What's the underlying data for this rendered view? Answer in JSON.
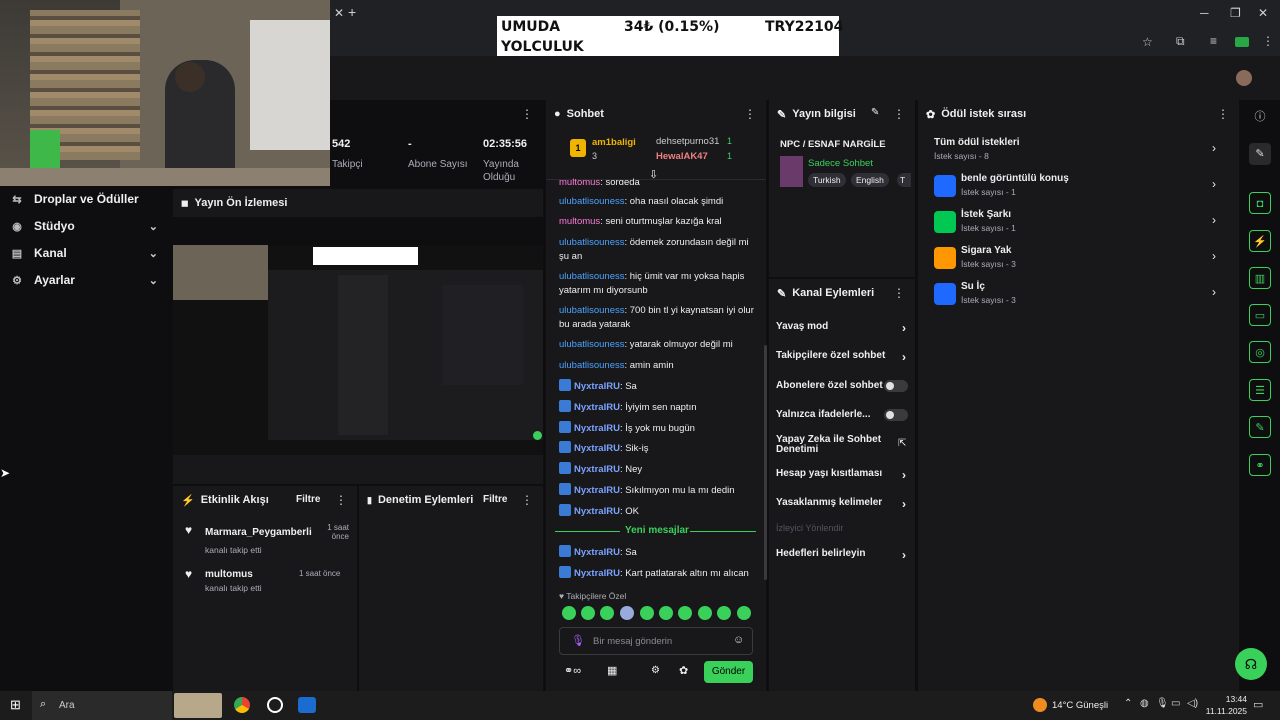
{
  "ticker": {
    "name_line1": "UMUDA",
    "name_line2": "YOLCULUK",
    "change": "34₺ (0.15%)",
    "code": "TRY22104"
  },
  "stats": [
    {
      "value": "542",
      "label": "Takipçi"
    },
    {
      "value": "-",
      "label": "Abone Sayısı"
    },
    {
      "value": "02:35:56",
      "label": "Yayında Olduğu"
    }
  ],
  "leftnav": [
    {
      "label": "Droplar ve Ödüller",
      "icon": "gift-icon"
    },
    {
      "label": "Stüdyo",
      "icon": "studio-icon"
    },
    {
      "label": "Kanal",
      "icon": "channel-icon"
    },
    {
      "label": "Ayarlar",
      "icon": "gear-icon"
    }
  ],
  "preview": {
    "title": "Yayın Ön İzlemesi"
  },
  "activity": {
    "title": "Etkinlik Akışı",
    "filter": "Filtre",
    "items": [
      {
        "user": "Marmara_Peygamberli",
        "text": "kanalı takip etti",
        "time": "1 saat önce"
      },
      {
        "user": "multomus",
        "text": "kanalı takip etti",
        "time": "1 saat önce"
      }
    ]
  },
  "moderation": {
    "title": "Denetim Eylemleri",
    "filter": "Filtre"
  },
  "chat": {
    "title": "Sohbet",
    "top_gifter": {
      "rank": "1",
      "name": "am1baligi",
      "count": "3"
    },
    "gifters": [
      {
        "name": "dehsetpurno31",
        "count": "1"
      },
      {
        "name": "HewalAK47",
        "count": "1"
      }
    ],
    "cut_msg": {
      "user": "multomus",
      "text": ": sorgeda"
    },
    "messages": [
      {
        "user": "ulubatlisouness",
        "text": ": oha nasıl olacak şimdi"
      },
      {
        "user": "multomus",
        "text": ": seni oturtmuşlar kazığa kral"
      },
      {
        "user": "ulubatlisouness",
        "text": ": ödemek zorundasın değil mi şu an"
      },
      {
        "user": "ulubatlisouness",
        "text": ": hiç ümit var mı yoksa hapis yatarım mı diyorsunb"
      },
      {
        "user": "ulubatlisouness",
        "text": ": 700 bin tl yi kaynatsan iyi olur bu arada yatarak"
      },
      {
        "user": "ulubatlisouness",
        "text": ": yatarak olmuyor değil mi"
      },
      {
        "user": "ulubatlisouness",
        "text": ": amin amin"
      },
      {
        "user": "NyxtraIRU",
        "text": ": Sa"
      },
      {
        "user": "NyxtraIRU",
        "text": ": İyiyim sen naptın"
      },
      {
        "user": "NyxtraIRU",
        "text": ": İş yok mu bugün"
      },
      {
        "user": "NyxtraIRU",
        "text": ": Sik-iş"
      },
      {
        "user": "NyxtraIRU",
        "text": ": Ney"
      },
      {
        "user": "NyxtraIRU",
        "text": ": Sıkılmıyon mu la mı dedin"
      },
      {
        "user": "NyxtraIRU",
        "text": ": OK"
      }
    ],
    "new_divider": "Yeni mesajlar",
    "new_messages": [
      {
        "user": "NyxtraIRU",
        "text": ": Sa"
      },
      {
        "user": "NyxtraIRU",
        "text": ": Kart patlatarak altın mı alıcan"
      }
    ],
    "followers_only": "Takipçilere Özel",
    "input_placeholder": "Bir mesaj gönderin",
    "send": "Gönder"
  },
  "stream_info": {
    "title": "Yayın bilgisi",
    "category": "NPC / ESNAF NARGİLE",
    "subtitle": "Sadece Sohbet",
    "tags": [
      "Turkish",
      "English",
      "T"
    ]
  },
  "channel_actions": {
    "title": "Kanal Eylemleri",
    "items": [
      {
        "label": "Yavaş mod",
        "kind": "chevron"
      },
      {
        "label": "Takipçilere özel sohbet",
        "kind": "chevron"
      },
      {
        "label": "Abonelere özel sohbet",
        "kind": "toggle"
      },
      {
        "label": "Yalnızca ifadelerle...",
        "kind": "toggle"
      },
      {
        "label": "Yapay Zeka ile Sohbet Denetimi",
        "kind": "external"
      },
      {
        "label": "Hesap yaşı kısıtlaması",
        "kind": "chevron"
      },
      {
        "label": "Yasaklanmış kelimeler",
        "kind": "chevron"
      },
      {
        "label": "İzleyici Yönlendir",
        "kind": "disabled"
      },
      {
        "label": "Hedefleri belirleyin",
        "kind": "chevron"
      }
    ]
  },
  "rewards": {
    "title": "Ödül istek sırası",
    "all": {
      "title": "Tüm ödül istekleri",
      "sub": "İstek sayısı - 8"
    },
    "items": [
      {
        "title": "benle görüntülü konuş",
        "sub": "İstek sayısı - 1",
        "color": "#1f69ff"
      },
      {
        "title": "İstek Şarkı",
        "sub": "İstek sayısı - 1",
        "color": "#00c853"
      },
      {
        "title": "Sigara Yak",
        "sub": "İstek sayısı - 3",
        "color": "#ff9800"
      },
      {
        "title": "Su İç",
        "sub": "İstek sayısı - 3",
        "color": "#1f69ff"
      }
    ]
  },
  "taskbar": {
    "search": "Ara",
    "weather": "14°C  Güneşli",
    "time": "13:44",
    "date": "11.11.2025"
  }
}
